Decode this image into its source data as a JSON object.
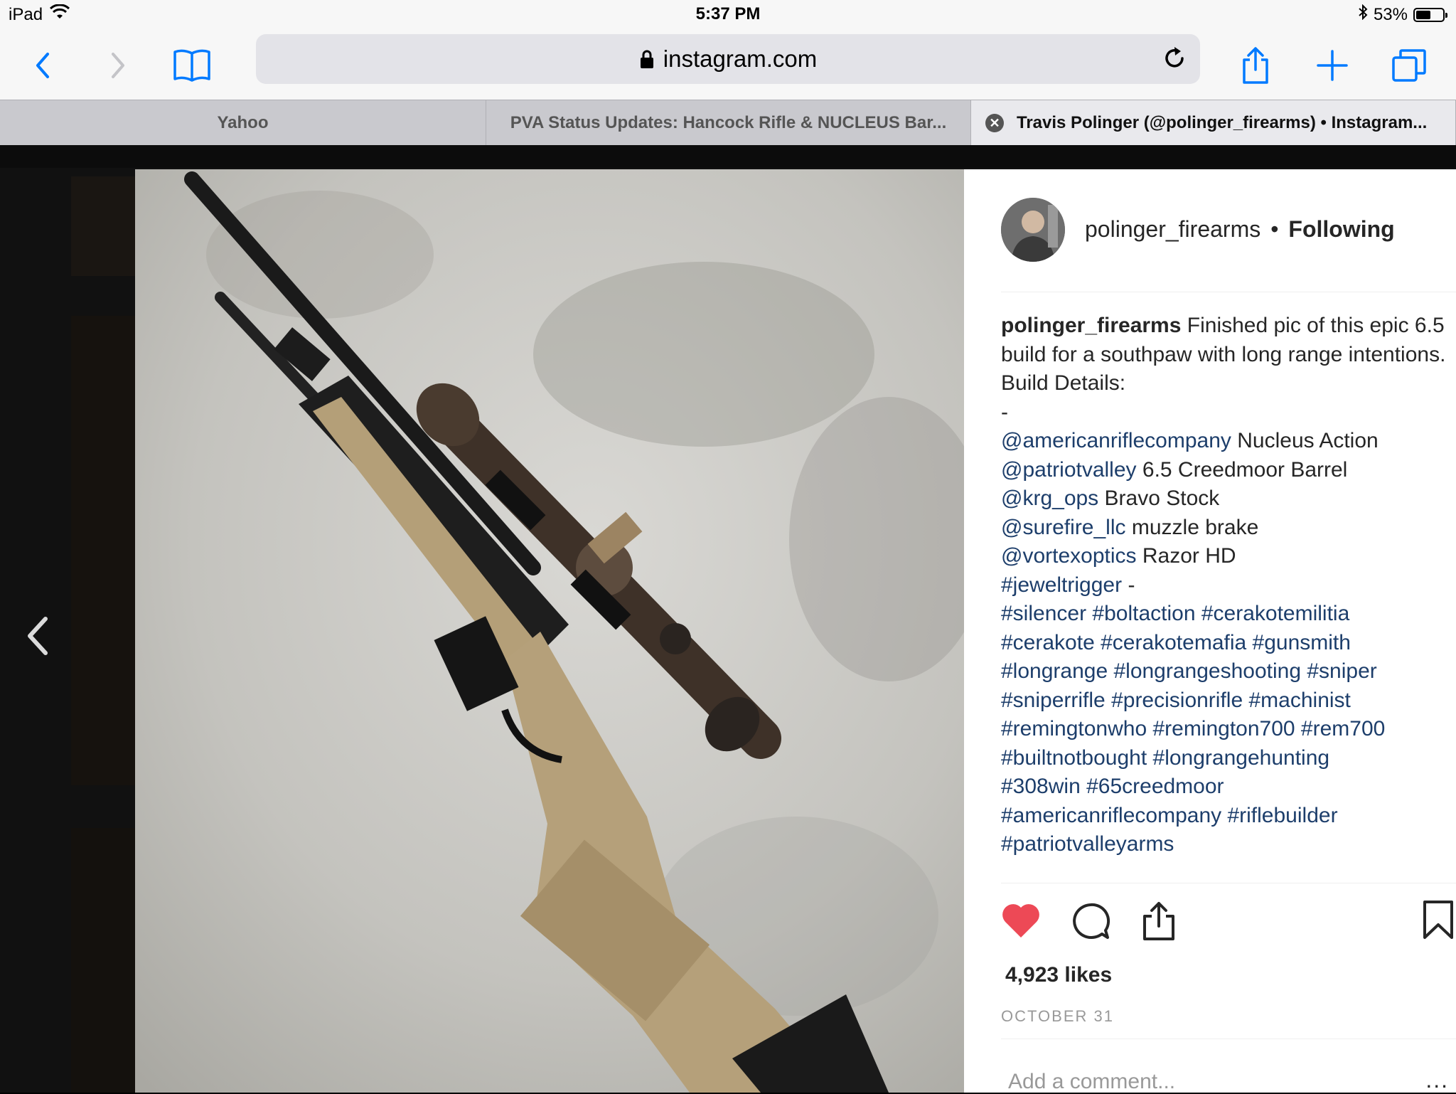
{
  "status_bar": {
    "device": "iPad",
    "time": "5:37 PM",
    "battery": "53%"
  },
  "toolbar": {
    "url": "instagram.com"
  },
  "tabs": [
    {
      "label": "Yahoo"
    },
    {
      "label": "PVA Status Updates: Hancock Rifle & NUCLEUS Bar..."
    },
    {
      "label": "Travis Polinger (@polinger_firearms) • Instagram..."
    }
  ],
  "post": {
    "username": "polinger_firearms",
    "separator": "•",
    "follow_status": "Following",
    "caption_user": "polinger_firearms",
    "caption_intro": "Finished pic of this epic 6.5 build for a southpaw with long range intentions.",
    "build_details_label": "Build Details:",
    "dash": "-",
    "parts": [
      {
        "handle": "@americanriflecompany",
        "text": "Nucleus Action"
      },
      {
        "handle": "@patriotvalley",
        "text": "6.5 Creedmoor Barrel"
      },
      {
        "handle": "@krg_ops",
        "text": "Bravo Stock"
      },
      {
        "handle": "@surefire_llc",
        "text": "muzzle brake"
      },
      {
        "handle": "@vortexoptics",
        "text": "Razor HD"
      },
      {
        "handle": "#jeweltrigger",
        "text": "-"
      }
    ],
    "hashtag_lines": [
      "#silencer #boltaction #cerakotemilitia",
      "#cerakote #cerakotemafia #gunsmith",
      "#longrange #longrangeshooting #sniper",
      "#sniperrifle #precisionrifle #machinist",
      "#remingtonwho #remington700 #rem700",
      "#builtnotbought #longrangehunting",
      "#308win #65creedmoor",
      "#americanriflecompany #riflebuilder",
      "#patriotvalleyarms"
    ],
    "likes": "4,923 likes",
    "date": "OCTOBER 31",
    "comment_placeholder": "Add a comment...",
    "more": "..."
  },
  "colors": {
    "accent": "#007aff",
    "link": "#1d3e6b",
    "like": "#ed4956"
  },
  "icons": [
    "wifi-icon",
    "bluetooth-icon",
    "battery-icon",
    "back-icon",
    "forward-icon",
    "bookmarks-icon",
    "lock-icon",
    "reload-icon",
    "share-icon",
    "new-tab-icon",
    "tabs-icon",
    "close-tab-icon",
    "prev-arrow-icon",
    "heart-icon",
    "comment-icon",
    "share-post-icon",
    "save-icon"
  ]
}
